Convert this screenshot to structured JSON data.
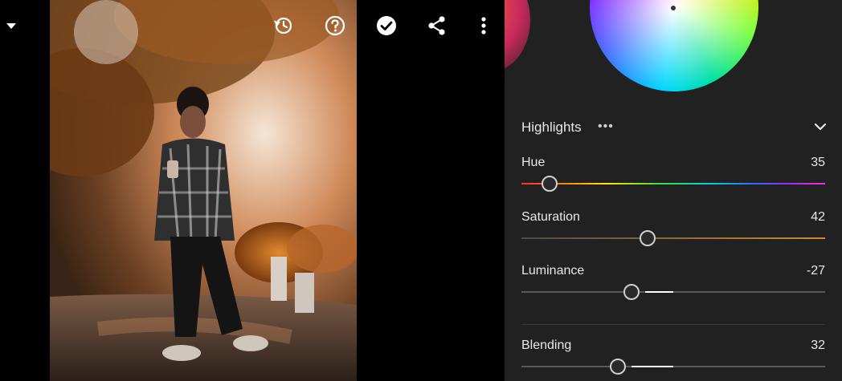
{
  "toolbar": {
    "icons": [
      "history-icon",
      "help-icon",
      "done-icon",
      "share-icon",
      "more-vertical-icon"
    ]
  },
  "panel": {
    "section": "Highlights",
    "section_more": "•••",
    "sliders": [
      {
        "label": "Hue",
        "value": "35",
        "level": 0.1
      },
      {
        "label": "Saturation",
        "value": "42",
        "level": 0.42
      },
      {
        "label": "Luminance",
        "value": "-27",
        "level": 0.37
      },
      {
        "label": "Blending",
        "value": "32",
        "level": 0.32
      }
    ]
  },
  "colors": {
    "panel_bg": "#212121",
    "saturation_track": "#d08a26",
    "accent": "#ffffff"
  }
}
